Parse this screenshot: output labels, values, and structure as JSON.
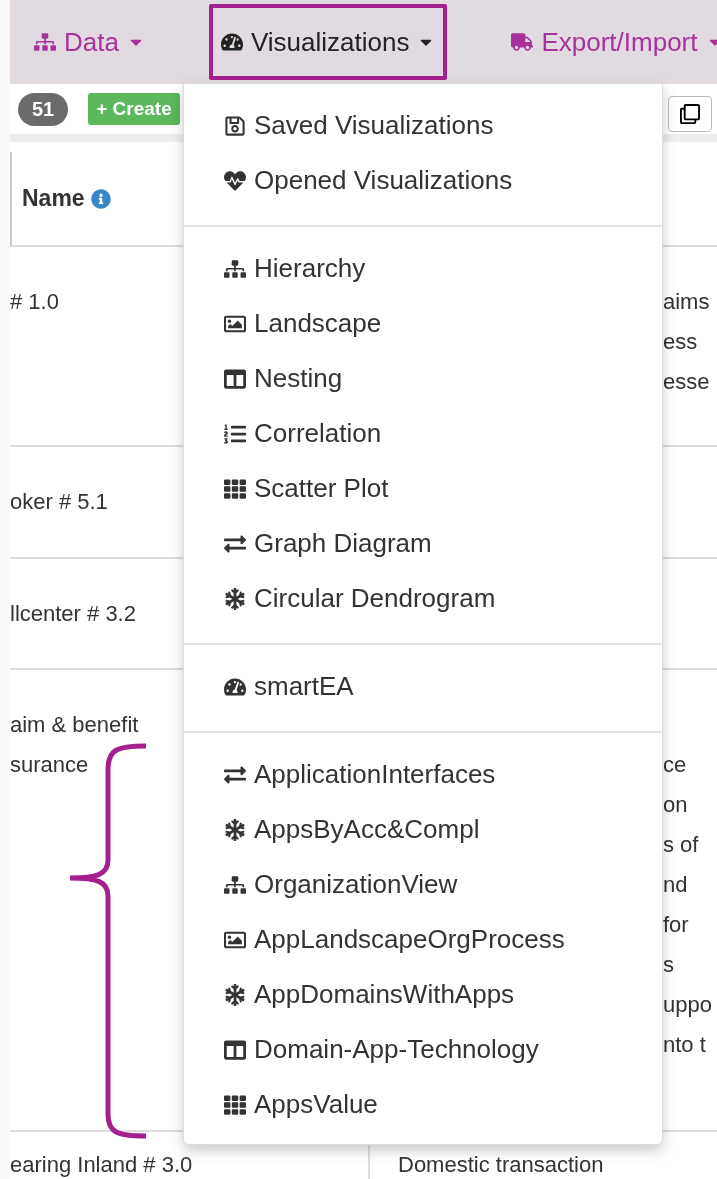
{
  "nav": [
    {
      "label": "Data",
      "kind": "data",
      "selected": false
    },
    {
      "label": "Visualizations",
      "kind": "visualizations",
      "selected": true
    },
    {
      "label": "Export/Import",
      "kind": "export",
      "selected": false
    }
  ],
  "toolbar": {
    "count": "51",
    "create_button": "+ Create"
  },
  "table": {
    "header": "Name",
    "rows": [
      {
        "kind": "partial",
        "name": [
          "# 1.0"
        ],
        "column_2": [
          "aims",
          "ess",
          "esse"
        ]
      },
      {
        "kind": "partial",
        "name": [
          "oker # 5.1"
        ],
        "column_2": []
      },
      {
        "kind": "partial",
        "name": [
          "llcenter # 3.2"
        ],
        "column_2": []
      },
      {
        "kind": "partial",
        "name": [
          "aim & benefit",
          "surance"
        ],
        "column_2": [
          "ce",
          "on",
          "s of",
          "nd",
          "for",
          "s",
          "uppo",
          "nto t"
        ]
      },
      {
        "kind": "full",
        "name": [
          "earing Inland # 3.0"
        ],
        "column_2": [
          "Domestic transaction"
        ]
      }
    ]
  },
  "menu": {
    "sections": [
      [
        {
          "label": "Saved Visualizations",
          "kind": "saved"
        },
        {
          "label": "Opened Visualizations",
          "kind": "opened"
        }
      ],
      [
        {
          "label": "Hierarchy",
          "kind": "hierarchy"
        },
        {
          "label": "Landscape",
          "kind": "landscape"
        },
        {
          "label": "Nesting",
          "kind": "nesting"
        },
        {
          "label": "Correlation",
          "kind": "correlation"
        },
        {
          "label": "Scatter Plot",
          "kind": "scatter"
        },
        {
          "label": "Graph Diagram",
          "kind": "graph"
        },
        {
          "label": "Circular Dendrogram",
          "kind": "dendrogram"
        }
      ],
      [
        {
          "label": "smartEA",
          "kind": "dashboard"
        }
      ],
      [
        {
          "label": "ApplicationInterfaces",
          "kind": "graph"
        },
        {
          "label": "AppsByAcc&Compl",
          "kind": "dendrogram"
        },
        {
          "label": "OrganizationView",
          "kind": "hierarchy"
        },
        {
          "label": "AppLandscapeOrgProcess",
          "kind": "landscape"
        },
        {
          "label": "AppDomainsWithApps",
          "kind": "dendrogram"
        },
        {
          "label": "Domain-App-Technology",
          "kind": "nesting"
        },
        {
          "label": "AppsValue",
          "kind": "scatter"
        }
      ]
    ]
  }
}
